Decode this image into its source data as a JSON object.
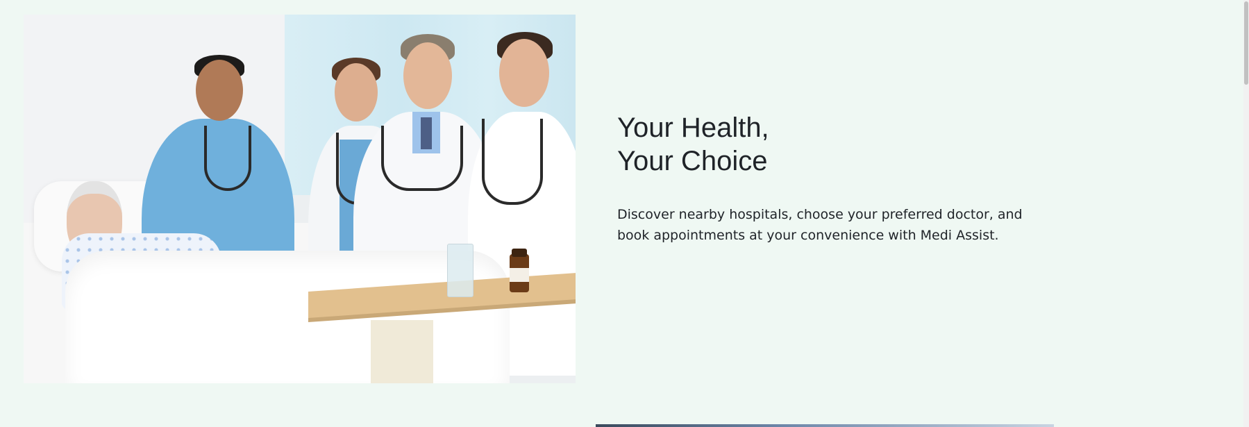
{
  "hero": {
    "title_line1": "Your Health,",
    "title_line2": "Your Choice",
    "description": "Discover nearby hospitals, choose your preferred doctor, and book appointments at your convenience with Medi Assist."
  },
  "colors": {
    "page_background": "#eff8f3",
    "text": "#1f2328"
  }
}
